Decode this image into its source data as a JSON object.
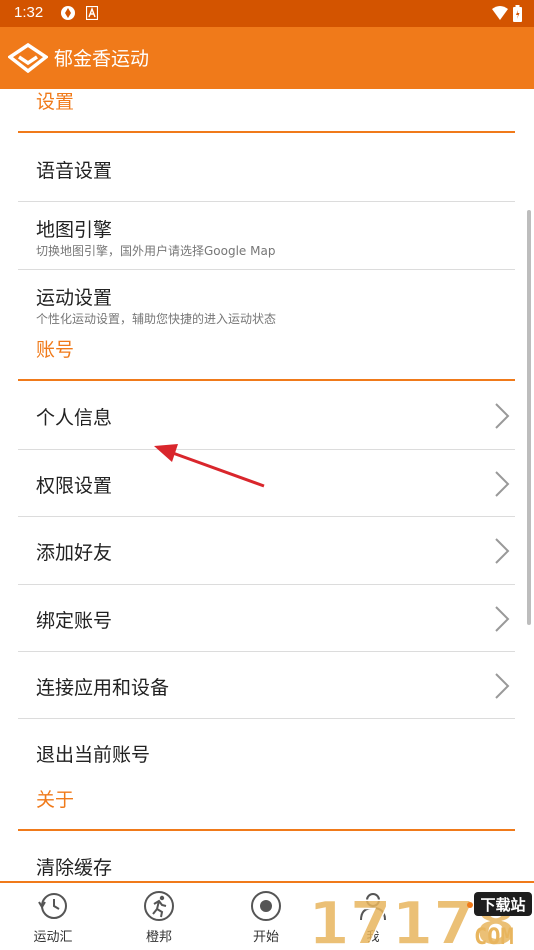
{
  "status_bar": {
    "time": "1:32"
  },
  "app_bar": {
    "title": "郁金香运动"
  },
  "sections": {
    "settings": {
      "title": "设置"
    },
    "account": {
      "title": "账号"
    },
    "about": {
      "title": "关于"
    }
  },
  "settings_items": [
    {
      "label": "语音设置"
    },
    {
      "label": "地图引擎",
      "subtitle": "切换地图引擎，国外用户请选择Google Map"
    },
    {
      "label": "运动设置",
      "subtitle": "个性化运动设置，辅助您快捷的进入运动状态"
    }
  ],
  "account_items": [
    {
      "label": "个人信息"
    },
    {
      "label": "权限设置"
    },
    {
      "label": "添加好友"
    },
    {
      "label": "绑定账号"
    },
    {
      "label": "连接应用和设备"
    },
    {
      "label": "退出当前账号"
    }
  ],
  "about_items": [
    {
      "label": "清除缓存"
    }
  ],
  "bottom_nav": [
    {
      "label": "运动汇"
    },
    {
      "label": "橙邦"
    },
    {
      "label": "开始"
    },
    {
      "label": "我"
    }
  ],
  "watermark": {
    "text": "17178",
    "badge": "下载站",
    "suffix": "COM"
  },
  "colors": {
    "accent": "#f07a1a",
    "status_bar": "#d35400",
    "annotation_arrow": "#d9262c"
  }
}
